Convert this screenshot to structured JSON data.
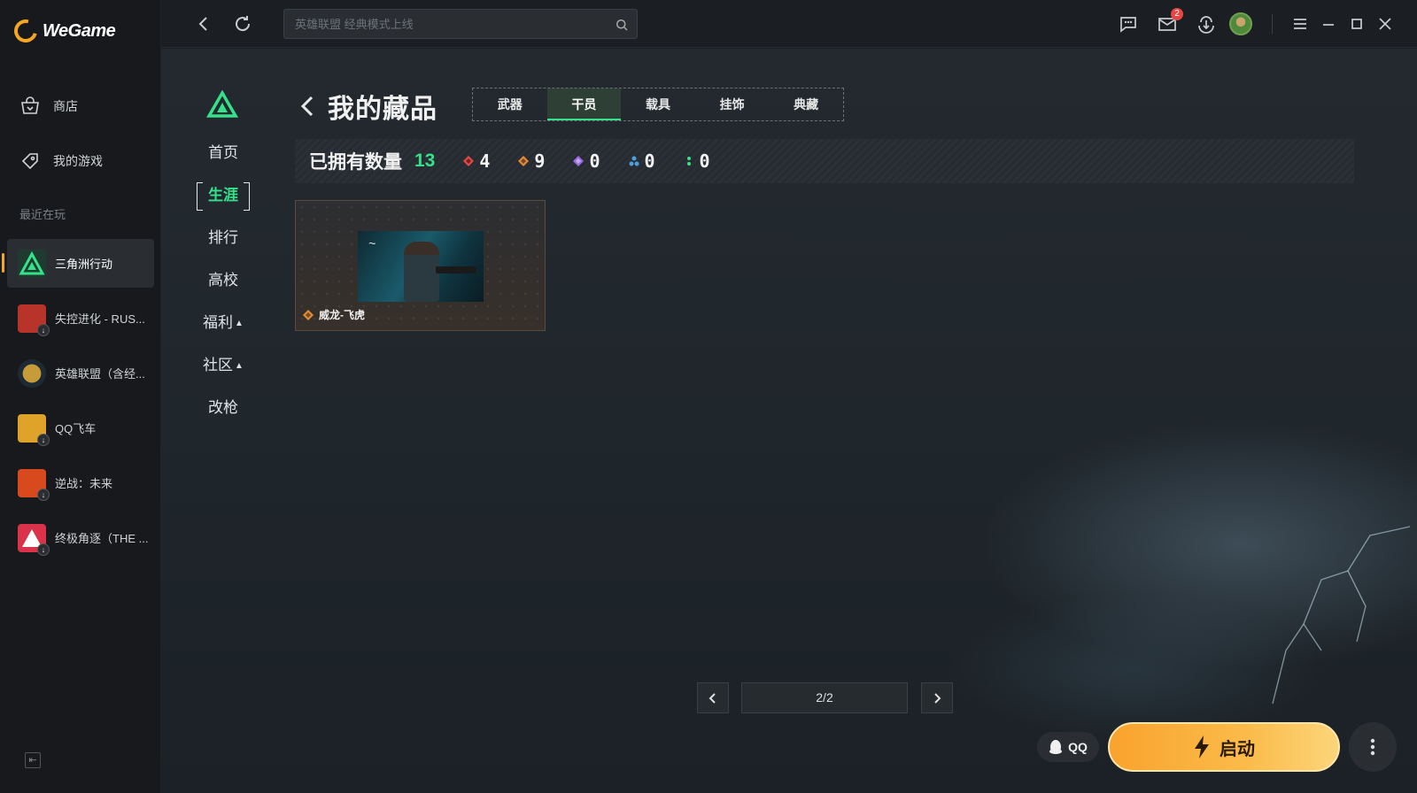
{
  "app": {
    "brand": "WeGame"
  },
  "sidebar": {
    "nav": [
      {
        "label": "商店",
        "icon": "store-icon"
      },
      {
        "label": "我的游戏",
        "icon": "my-games-icon"
      }
    ],
    "recent_label": "最近在玩",
    "recent_games": [
      {
        "name": "三角洲行动",
        "active": true,
        "color": "#1f3a2e"
      },
      {
        "name": "失控进化 - RUS...",
        "active": false,
        "color": "#b8332a"
      },
      {
        "name": "英雄联盟（含经...",
        "active": false,
        "color": "#c79a3a"
      },
      {
        "name": "QQ飞车",
        "active": false,
        "color": "#e0a32a"
      },
      {
        "name": "逆战：未来",
        "active": false,
        "color": "#d84a1e"
      },
      {
        "name": "终极角逐（THE ...",
        "active": false,
        "color": "#d9324a"
      }
    ]
  },
  "topbar": {
    "search_placeholder": "英雄联盟 经典模式上线",
    "mail_badge": "2"
  },
  "game_nav": {
    "items": [
      {
        "label": "首页",
        "active": false,
        "caret": false
      },
      {
        "label": "生涯",
        "active": true,
        "caret": false
      },
      {
        "label": "排行",
        "active": false,
        "caret": false
      },
      {
        "label": "高校",
        "active": false,
        "caret": false
      },
      {
        "label": "福利",
        "active": false,
        "caret": true
      },
      {
        "label": "社区",
        "active": false,
        "caret": true
      },
      {
        "label": "改枪",
        "active": false,
        "caret": false
      }
    ]
  },
  "collection": {
    "title": "我的藏品",
    "tabs": [
      {
        "label": "武器",
        "active": false
      },
      {
        "label": "干员",
        "active": true
      },
      {
        "label": "载具",
        "active": false
      },
      {
        "label": "挂饰",
        "active": false
      },
      {
        "label": "典藏",
        "active": false
      }
    ],
    "owned_label": "已拥有数量",
    "owned_count": "13",
    "rarities": [
      {
        "count": "4",
        "color": "#e24a4a"
      },
      {
        "count": "9",
        "color": "#e08a3a"
      },
      {
        "count": "0",
        "color": "#9a6ae0"
      },
      {
        "count": "0",
        "color": "#4aa0e0"
      },
      {
        "count": "0",
        "color": "#35e28a"
      }
    ],
    "items": [
      {
        "name": "威龙-飞虎",
        "rarity_color": "#e08a3a"
      }
    ],
    "pagination": "2/2"
  },
  "launch": {
    "qq_label": "QQ",
    "start_label": "启动"
  }
}
